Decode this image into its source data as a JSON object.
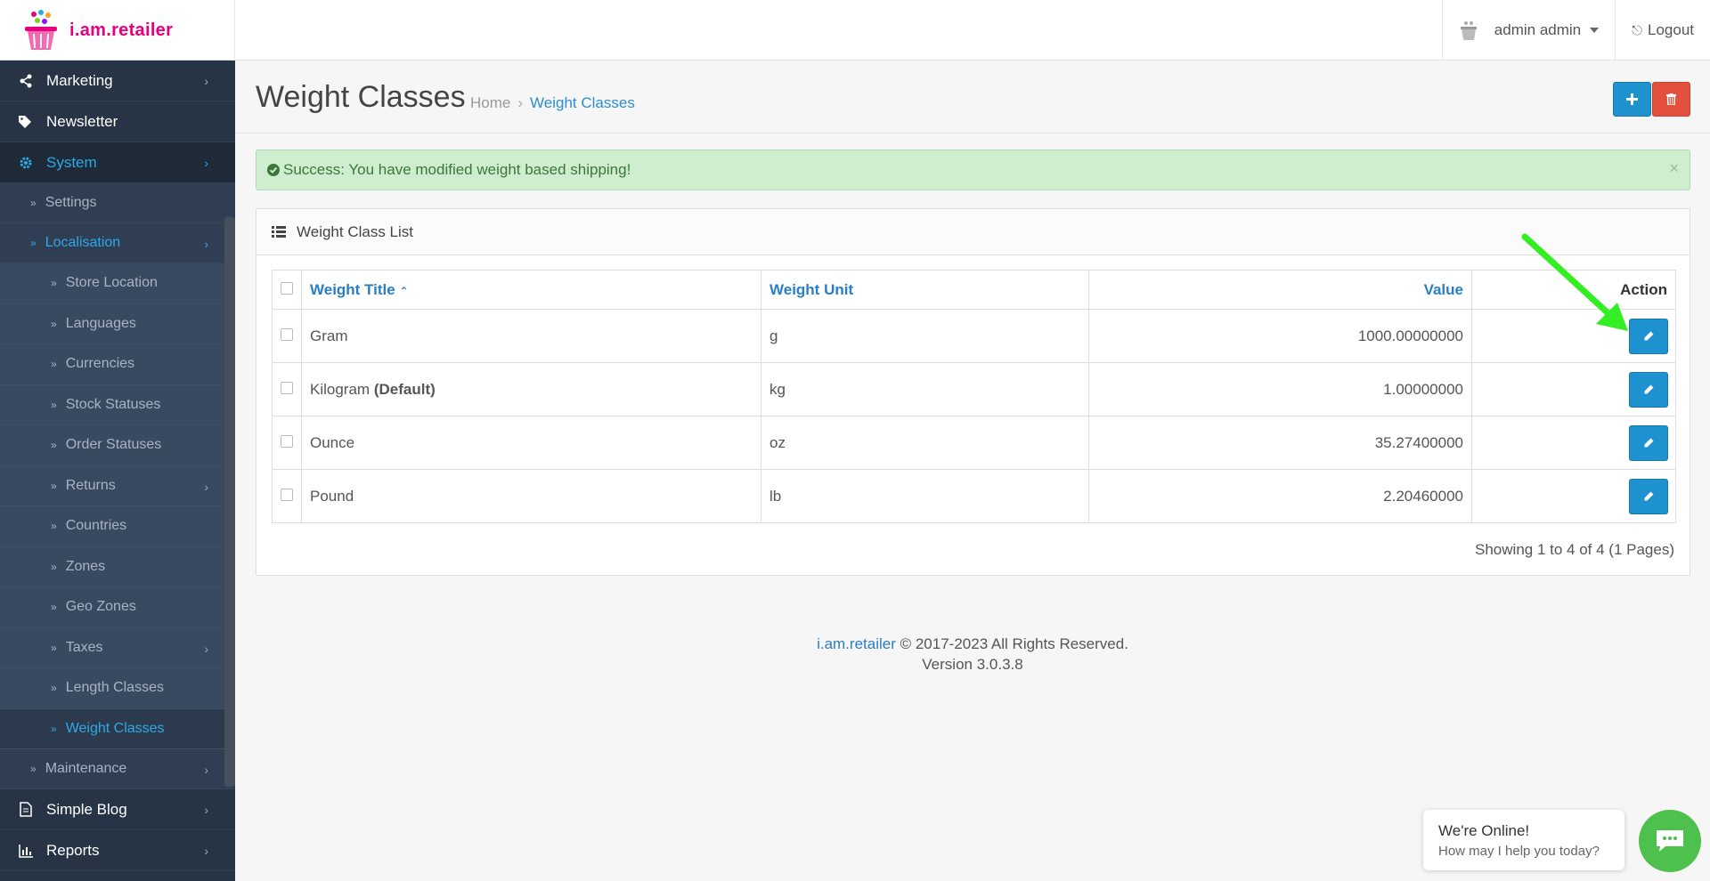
{
  "brand": {
    "name": "i.am.retailer"
  },
  "header": {
    "user_label": "admin admin",
    "logout_label": "Logout"
  },
  "sidebar": {
    "items": [
      {
        "label": "Marketing",
        "level": 0
      },
      {
        "label": "Newsletter",
        "level": 0
      },
      {
        "label": "System",
        "level": 0
      },
      {
        "label": "Settings",
        "level": 1
      },
      {
        "label": "Localisation",
        "level": 1
      },
      {
        "label": "Store Location",
        "level": 2
      },
      {
        "label": "Languages",
        "level": 2
      },
      {
        "label": "Currencies",
        "level": 2
      },
      {
        "label": "Stock Statuses",
        "level": 2
      },
      {
        "label": "Order Statuses",
        "level": 2
      },
      {
        "label": "Returns",
        "level": 2
      },
      {
        "label": "Countries",
        "level": 2
      },
      {
        "label": "Zones",
        "level": 2
      },
      {
        "label": "Geo Zones",
        "level": 2
      },
      {
        "label": "Taxes",
        "level": 2
      },
      {
        "label": "Length Classes",
        "level": 2
      },
      {
        "label": "Weight Classes",
        "level": 2
      },
      {
        "label": "Maintenance",
        "level": 1
      },
      {
        "label": "Simple Blog",
        "level": 0
      },
      {
        "label": "Reports",
        "level": 0
      }
    ]
  },
  "page": {
    "title": "Weight Classes",
    "breadcrumb": {
      "home": "Home",
      "sep": "›",
      "current": "Weight Classes"
    }
  },
  "alert": {
    "text": "Success: You have modified weight based shipping!",
    "close": "×"
  },
  "panel": {
    "title": "Weight Class List"
  },
  "table": {
    "headers": {
      "title": "Weight Title",
      "unit": "Weight Unit",
      "value": "Value",
      "action": "Action"
    },
    "rows": [
      {
        "title": "Gram",
        "default": "",
        "unit": "g",
        "value": "1000.00000000"
      },
      {
        "title": "Kilogram",
        "default": "(Default)",
        "unit": "kg",
        "value": "1.00000000"
      },
      {
        "title": "Ounce",
        "default": "",
        "unit": "oz",
        "value": "35.27400000"
      },
      {
        "title": "Pound",
        "default": "",
        "unit": "lb",
        "value": "2.20460000"
      }
    ]
  },
  "pager": {
    "info": "Showing 1 to 4 of 4 (1 Pages)"
  },
  "footer": {
    "brand_link": "i.am.retailer",
    "copyright": " © 2017-2023 All Rights Reserved.",
    "version": "Version 3.0.3.8"
  },
  "chat": {
    "line1": "We're Online!",
    "line2": "How may I help you today?"
  },
  "colors": {
    "primary": "#1e91cf",
    "danger": "#e3503e",
    "sidebar": "#263445",
    "success_bg": "#cfeecf",
    "annotation_arrow": "#33ee22"
  }
}
